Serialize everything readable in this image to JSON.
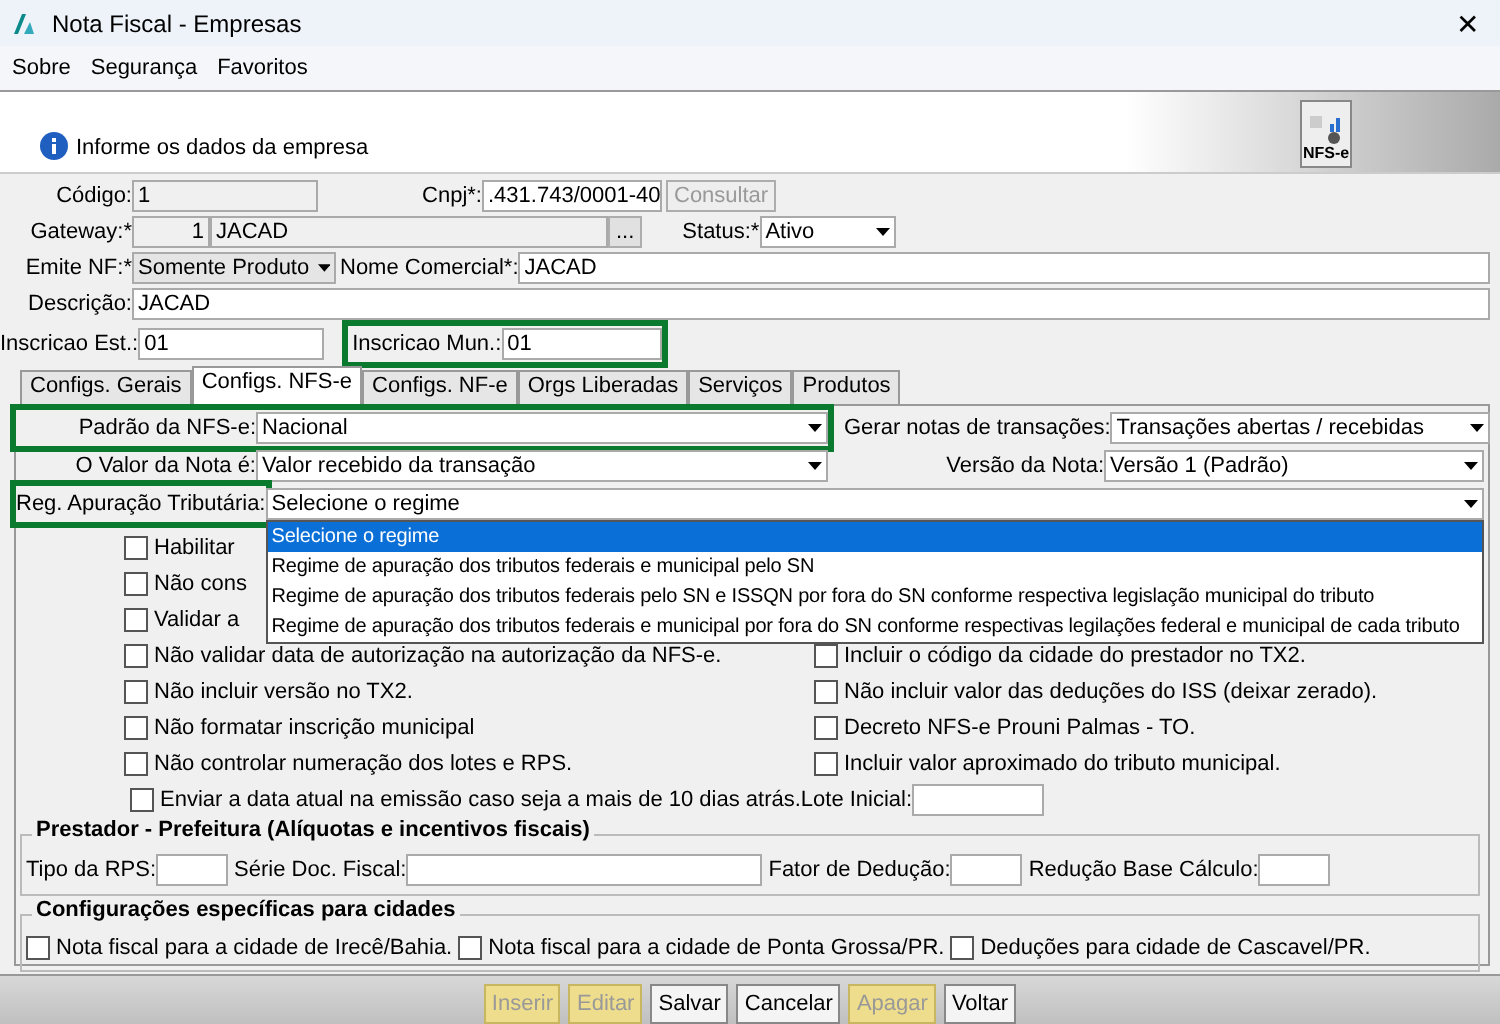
{
  "window": {
    "title": "Nota Fiscal - Empresas",
    "close": "✕"
  },
  "menu": [
    {
      "label": "Sobre"
    },
    {
      "label": "Segurança"
    },
    {
      "label": "Favoritos"
    }
  ],
  "header": {
    "message": "Informe os dados da empresa",
    "badge": "NFS-e"
  },
  "codigo": {
    "label": "Código:",
    "value": "1"
  },
  "cnpj": {
    "label": "Cnpj*:",
    "value": ".431.743/0001-40",
    "button": {
      "label": "Consultar",
      "disabled": true
    }
  },
  "gateway": {
    "label": "Gateway:*",
    "code": "1",
    "name": "JACAD",
    "button": "..."
  },
  "status": {
    "label": "Status:*",
    "value": "Ativo"
  },
  "emite_nf": {
    "label": "Emite NF:*",
    "value": "Somente Produto"
  },
  "nome_comercial": {
    "label": "Nome Comercial*:",
    "value": "JACAD"
  },
  "descricao": {
    "label": "Descrição:",
    "value": "JACAD"
  },
  "inscricao_est": {
    "label": "Inscricao Est.:",
    "value": "01"
  },
  "inscricao_mun": {
    "label": "Inscricao Mun.:",
    "value": "01",
    "highlighted": true
  },
  "tabs": [
    {
      "label": "Configs. Gerais",
      "selected": false
    },
    {
      "label": "Configs. NFS-e",
      "selected": true
    },
    {
      "label": "Configs. NF-e",
      "selected": false
    },
    {
      "label": "Orgs Liberadas",
      "selected": false
    },
    {
      "label": "Serviços",
      "selected": false
    },
    {
      "label": "Produtos",
      "selected": false
    }
  ],
  "padrao": {
    "label": "Padrão da NFS-e:",
    "value": "Nacional",
    "highlighted": true
  },
  "gerar_notas": {
    "label": "Gerar notas de transações:",
    "value": "Transações abertas / recebidas"
  },
  "valor_nota": {
    "label": "O Valor da Nota é:",
    "value": "Valor recebido da transação"
  },
  "versao": {
    "label": "Versão da Nota:",
    "value": "Versão 1 (Padrão)"
  },
  "regime": {
    "label": "Reg. Apuração Tributária:",
    "value": "Selecione o regime",
    "highlighted": true,
    "expanded": true,
    "options": [
      {
        "label": "Selecione o regime",
        "selected": true
      },
      {
        "label": "Regime de apuração dos tributos federais e municipal pelo SN",
        "selected": false
      },
      {
        "label": "Regime de apuração dos tributos federais pelo SN e ISSQN por fora do SN conforme respectiva legislação municipal do tributo",
        "selected": false
      },
      {
        "label": "Regime de apuração dos tributos federais e municipal por fora do SN conforme respectivas legilações federal e municipal de cada tributo",
        "selected": false
      }
    ]
  },
  "options_left": [
    {
      "label": "Habilitar",
      "checked": false
    },
    {
      "label": "Não cons",
      "checked": false
    },
    {
      "label": "Validar a",
      "checked": false
    },
    {
      "label": "Não validar data de autorização na autorização da NFS-e.",
      "checked": false
    },
    {
      "label": "Não incluir versão no TX2.",
      "checked": false
    },
    {
      "label": "Não formatar inscrição municipal",
      "checked": false
    },
    {
      "label": "Não controlar numeração dos lotes e RPS.",
      "checked": false
    }
  ],
  "options_right": [
    {
      "label": "Incluir o código da cidade do prestador no TX2.",
      "checked": false
    },
    {
      "label": "Não incluir valor das deduções do ISS (deixar zerado).",
      "checked": false
    },
    {
      "label": "Decreto NFS-e Prouni Palmas - TO.",
      "checked": false
    },
    {
      "label": "Incluir valor aproximado do tributo municipal.",
      "checked": false
    }
  ],
  "enviar_data": {
    "label": "Enviar a data atual na emissão caso seja a mais de 10 dias atrás.",
    "checked": false,
    "lote_label": "Lote Inicial:"
  },
  "prestador": {
    "title": "Prestador - Prefeitura (Alíquotas e incentivos fiscais)",
    "fields": [
      {
        "label": "Tipo da RPS:"
      },
      {
        "label": "Série Doc. Fiscal:"
      },
      {
        "label": "Fator de Dedução:"
      },
      {
        "label": "Redução Base Cálculo:"
      }
    ]
  },
  "cidades": {
    "title": "Configurações específicas para cidades",
    "options": [
      {
        "label": "Nota fiscal para a cidade de Irecê/Bahia.",
        "checked": false
      },
      {
        "label": "Nota fiscal para a cidade de Ponta Grossa/PR.",
        "checked": false
      },
      {
        "label": "Deduções para cidade de Cascavel/PR.",
        "checked": false
      }
    ]
  },
  "buttons": [
    {
      "label": "Inserir",
      "disabled": true
    },
    {
      "label": "Editar",
      "disabled": true
    },
    {
      "label": "Salvar",
      "disabled": false
    },
    {
      "label": "Cancelar",
      "disabled": false
    },
    {
      "label": "Apagar",
      "disabled": true
    },
    {
      "label": "Voltar",
      "disabled": false
    }
  ]
}
